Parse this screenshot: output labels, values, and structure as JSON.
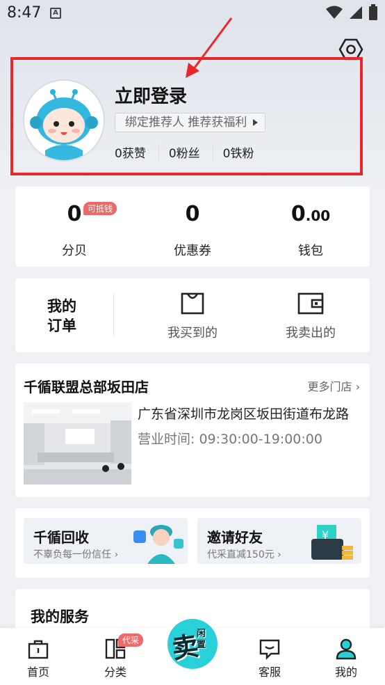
{
  "status_bar": {
    "time": "8:47",
    "notif_glyph": "A"
  },
  "header": {
    "settings_icon": "gear-hex-icon"
  },
  "profile": {
    "title": "立即登录",
    "bind_text": "绑定推荐人 推荐获福利",
    "stats": [
      {
        "label": "0获赞"
      },
      {
        "label": "0粉丝"
      },
      {
        "label": "0铁粉"
      }
    ]
  },
  "wallet": {
    "items": [
      {
        "value": "0",
        "label": "分贝",
        "badge": "可抵钱"
      },
      {
        "value": "0",
        "label": "优惠券"
      },
      {
        "value": "0",
        "decimal": ".00",
        "label": "钱包"
      }
    ]
  },
  "orders": {
    "title_line1": "我的",
    "title_line2": "订单",
    "bought": "我买到的",
    "sold": "我卖出的"
  },
  "store": {
    "name": "千循联盟总部坂田店",
    "more": "更多门店",
    "address": "广东省深圳市龙岗区坂田街道布龙路",
    "hours": "营业时间: 09:30:00-19:00:00"
  },
  "promos": [
    {
      "title": "千循回收",
      "subtitle": "不辜负每一份信任"
    },
    {
      "title": "邀请好友",
      "subtitle": "代采直减150元"
    }
  ],
  "services": {
    "title": "我的服务"
  },
  "nav": {
    "home": "首页",
    "category": "分类",
    "category_badge": "代采",
    "sell_main": "卖",
    "sell_side": "闲置",
    "service": "客服",
    "mine": "我的"
  },
  "colors": {
    "highlight_box": "#e8262b",
    "accent": "#2ad0d8",
    "badge": "#e86a6a"
  }
}
